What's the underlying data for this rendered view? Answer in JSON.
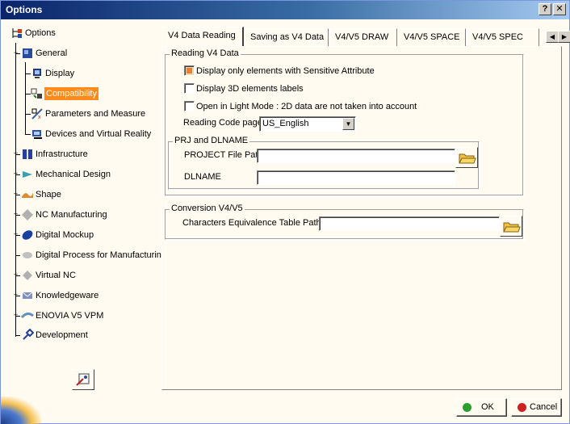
{
  "window": {
    "title": "Options",
    "help_label": "?",
    "close_label": "✕"
  },
  "tree": {
    "items": [
      {
        "label": "Options",
        "icon": "options-tree-icon",
        "color": "#c04020"
      },
      {
        "label": "General",
        "icon": "general-icon",
        "color": "#2a4a9a"
      },
      {
        "label": "Display",
        "icon": "display-icon",
        "color": "#203a80"
      },
      {
        "label": "Compatibility",
        "icon": "compatibility-icon",
        "color": "#404040",
        "selected": true
      },
      {
        "label": "Parameters and Measure",
        "icon": "parameters-icon",
        "color": "#4060a0"
      },
      {
        "label": "Devices and Virtual Reality",
        "icon": "devices-icon",
        "color": "#3050a0"
      },
      {
        "label": "Infrastructure",
        "icon": "infrastructure-icon",
        "color": "#2a3ea0"
      },
      {
        "label": "Mechanical Design",
        "icon": "mechanical-design-icon",
        "color": "#3aa0b0"
      },
      {
        "label": "Shape",
        "icon": "shape-icon",
        "color": "#e08a30"
      },
      {
        "label": "NC Manufacturing",
        "icon": "nc-manufacturing-icon",
        "color": "#b0b0b0"
      },
      {
        "label": "Digital Mockup",
        "icon": "digital-mockup-icon",
        "color": "#1a40a0"
      },
      {
        "label": "Digital Process for Manufacturing",
        "icon": "digital-process-icon",
        "color": "#c0c0c0"
      },
      {
        "label": "Virtual NC",
        "icon": "virtual-nc-icon",
        "color": "#b0b0b0"
      },
      {
        "label": "Knowledgeware",
        "icon": "knowledgeware-icon",
        "color": "#8090c0"
      },
      {
        "label": "ENOVIA V5 VPM",
        "icon": "enovia-icon",
        "color": "#6090c0"
      },
      {
        "label": "Development",
        "icon": "development-icon",
        "color": "#2040a0"
      }
    ]
  },
  "tabs": [
    {
      "label": "V4 Data Reading",
      "active": true
    },
    {
      "label": "Saving as V4 Data"
    },
    {
      "label": "V4/V5 DRAW"
    },
    {
      "label": "V4/V5 SPACE"
    },
    {
      "label": "V4/V5 SPEC"
    }
  ],
  "reading": {
    "group_title": "Reading V4 Data",
    "options": [
      {
        "label": "Display only elements with Sensitive Attribute",
        "checked": true
      },
      {
        "label": "Display 3D elements labels",
        "checked": false
      },
      {
        "label": "Open in Light Mode : 2D data are not taken into account",
        "checked": false
      }
    ],
    "code_page_label": "Reading Code page",
    "code_page_value": "US_English",
    "prj_group_title": "PRJ and DLNAME",
    "project_label": "PROJECT File Path",
    "project_value": "",
    "dlname_label": "DLNAME",
    "dlname_value": ""
  },
  "conversion": {
    "group_title": "Conversion V4/V5",
    "table_label": "Characters Equivalence Table Path",
    "table_value": ""
  },
  "buttons": {
    "ok": "OK",
    "cancel": "Cancel"
  },
  "colors": {
    "selection": "#ff8a1a",
    "ok_dot": "#2aa02a",
    "cancel_dot": "#d02020",
    "title_start": "#0a246a",
    "title_end": "#a6caf0"
  }
}
